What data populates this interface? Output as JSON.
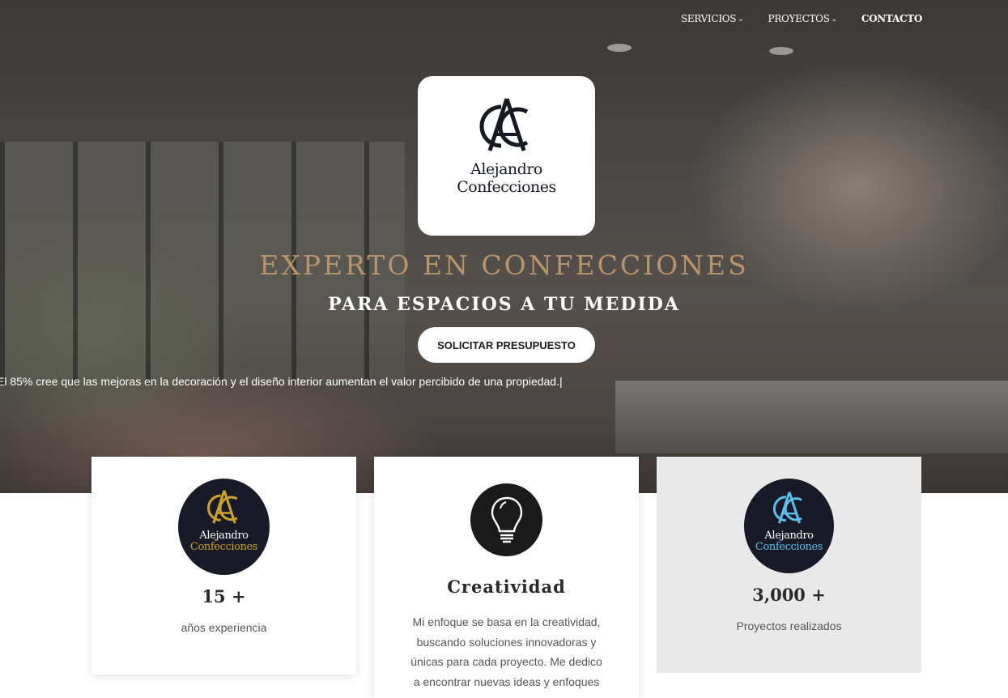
{
  "nav": {
    "items": [
      {
        "label": "SERVICIOS",
        "dropdown": true
      },
      {
        "label": "PROYECTOS",
        "dropdown": true
      },
      {
        "label": "CONTACTO",
        "dropdown": false
      }
    ]
  },
  "logo": {
    "monogram": "AC",
    "line1": "Alejandro",
    "line2": "Confecciones"
  },
  "hero": {
    "title": "EXPERTO EN CONFECCIONES",
    "subtitle": "PARA ESPACIOS A TU MEDIDA",
    "cta_label": "SOLICITAR PRESUPUESTO",
    "ticker": "El 85% cree que las mejoras en la decoración y el diseño interior aumentan el valor percibido de una propiedad.|"
  },
  "cards": [
    {
      "icon": "ac-logo-gold-icon",
      "value": "15 +",
      "label": "años experiencia",
      "logo_line1": "Alejandro",
      "logo_line2": "Confecciones"
    },
    {
      "icon": "lightbulb-icon",
      "title": "Creatividad",
      "description": "Mi enfoque se basa en la creatividad, buscando soluciones innovadoras y únicas para cada proyecto. Me dedico a encontrar nuevas ideas y enfoques que"
    },
    {
      "icon": "ac-logo-blue-icon",
      "value": "3,000 +",
      "label": "Proyectos realizados",
      "logo_line1": "Alejandro",
      "logo_line2": "Confecciones"
    }
  ],
  "colors": {
    "accent_gold": "#b8946a",
    "logo_navy": "#151a22",
    "badge_bg": "#191a28",
    "badge_gold": "#c9a227",
    "badge_blue": "#5bc0eb"
  }
}
